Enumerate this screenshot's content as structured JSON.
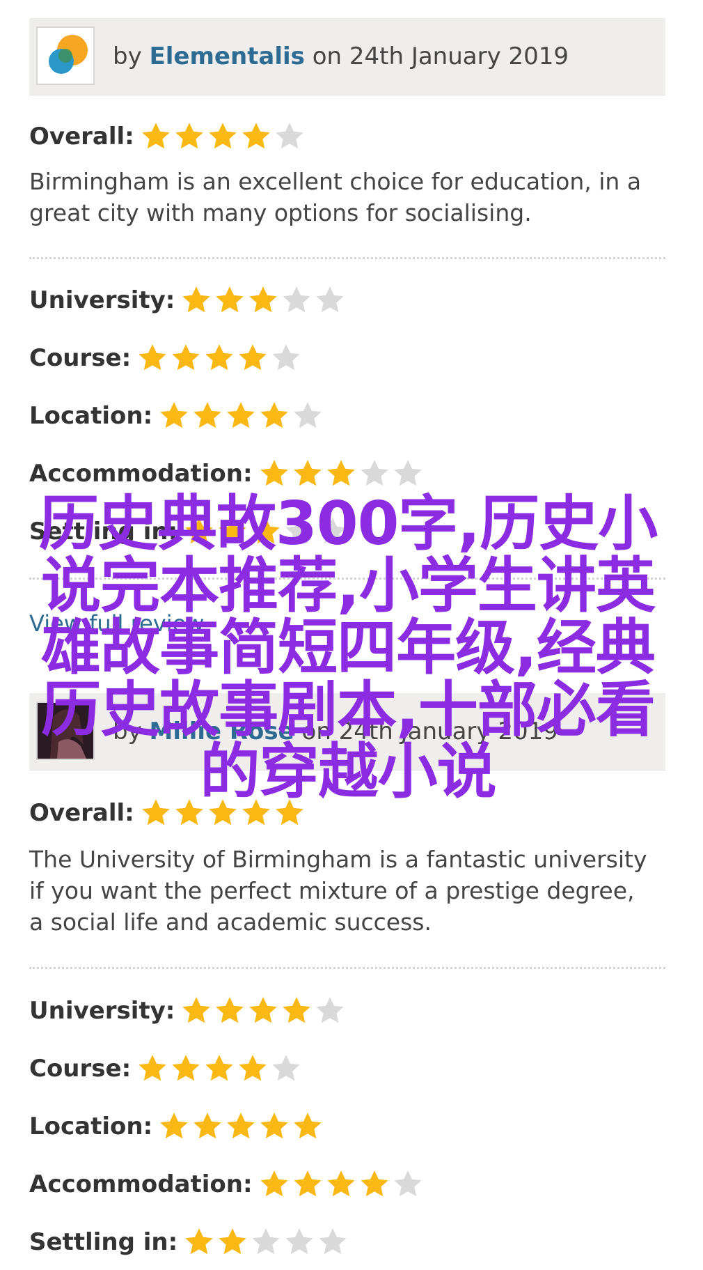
{
  "reviews": [
    {
      "by_prefix": "by",
      "author": "Elementalis",
      "date_text": "on 24th January 2019",
      "overall_label": "Overall:",
      "overall_stars": 4,
      "comment": "Birmingham is an excellent choice for education, in a great city with many options for socialising.",
      "ratings": [
        {
          "label": "University:",
          "stars": 3
        },
        {
          "label": "Course:",
          "stars": 4
        },
        {
          "label": "Location:",
          "stars": 4
        },
        {
          "label": "Accommodation:",
          "stars": 3
        },
        {
          "label": "Settling in:",
          "stars": 3
        }
      ],
      "link": "View full review"
    },
    {
      "by_prefix": "by",
      "author": "Millie Rose",
      "date_text": "on 24th January 2019",
      "overall_label": "Overall:",
      "overall_stars": 5,
      "comment": "The University of Birmingham is a fantastic university if you want the perfect mixture of a prestige degree, a social life and academic success.",
      "ratings": [
        {
          "label": "University:",
          "stars": 4
        },
        {
          "label": "Course:",
          "stars": 4
        },
        {
          "label": "Location:",
          "stars": 5
        },
        {
          "label": "Accommodation:",
          "stars": 4
        },
        {
          "label": "Settling in:",
          "stars": 2
        }
      ]
    }
  ],
  "overlay_text": "历史典故300字,历史小说完本推荐,小学生讲英雄故事简短四年级,经典历史故事剧本,十部必看的穿越小说",
  "colors": {
    "star_filled": "#f9b814",
    "star_empty": "#d9d9d9",
    "link": "#2e6b93",
    "overlay": "#8b2be2"
  }
}
